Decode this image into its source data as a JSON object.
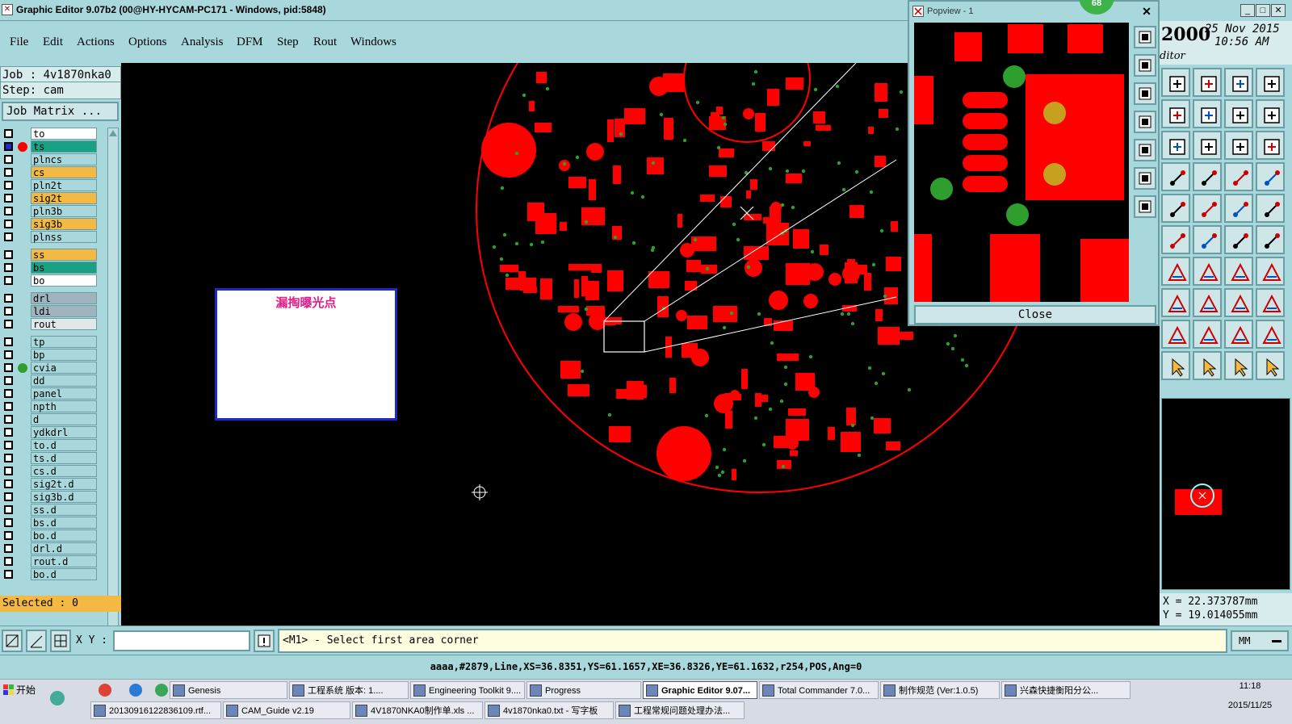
{
  "window": {
    "title": "Graphic Editor 9.07b2 (00@HY-HYCAM-PC171 - Windows, pid:5848)"
  },
  "menu": [
    {
      "label": "File"
    },
    {
      "label": "Edit"
    },
    {
      "label": "Actions"
    },
    {
      "label": "Options"
    },
    {
      "label": "Analysis"
    },
    {
      "label": "DFM"
    },
    {
      "label": "Step"
    },
    {
      "label": "Rout"
    },
    {
      "label": "Windows"
    }
  ],
  "job": {
    "job_line": "Job : 4v1870nka0",
    "step_line": "Step: cam",
    "matrix_button": "Job Matrix ..."
  },
  "layers": [
    {
      "name": "to",
      "color": "#ffffff"
    },
    {
      "name": "ts",
      "color": "#1aa083",
      "active": true
    },
    {
      "name": "plncs",
      "color": "#a8d8dc"
    },
    {
      "name": "cs",
      "color": "#f4b942"
    },
    {
      "name": "pln2t",
      "color": "#a8d8dc"
    },
    {
      "name": "sig2t",
      "color": "#f4b942"
    },
    {
      "name": "pln3b",
      "color": "#a8d8dc"
    },
    {
      "name": "sig3b",
      "color": "#f4b942"
    },
    {
      "name": "plnss",
      "color": "#a8d8dc"
    },
    {
      "name": "ss",
      "color": "#f4b942"
    },
    {
      "name": "bs",
      "color": "#1aa083"
    },
    {
      "name": "bo",
      "color": "#ffffff"
    },
    {
      "name": "drl",
      "color": "#9fb4bd"
    },
    {
      "name": "ldi",
      "color": "#9fb4bd"
    },
    {
      "name": "rout",
      "color": "#e0e8ea"
    },
    {
      "name": "tp",
      "color": "#a8d8dc"
    },
    {
      "name": "bp",
      "color": "#a8d8dc"
    },
    {
      "name": "cvia",
      "color": "#a8d8dc"
    },
    {
      "name": "dd",
      "color": "#a8d8dc"
    },
    {
      "name": "panel",
      "color": "#a8d8dc"
    },
    {
      "name": "npth",
      "color": "#a8d8dc"
    },
    {
      "name": "d",
      "color": "#a8d8dc"
    },
    {
      "name": "ydkdrl",
      "color": "#a8d8dc"
    },
    {
      "name": "to.d",
      "color": "#a8d8dc"
    },
    {
      "name": "ts.d",
      "color": "#a8d8dc"
    },
    {
      "name": "cs.d",
      "color": "#a8d8dc"
    },
    {
      "name": "sig2t.d",
      "color": "#a8d8dc"
    },
    {
      "name": "sig3b.d",
      "color": "#a8d8dc"
    },
    {
      "name": "ss.d",
      "color": "#a8d8dc"
    },
    {
      "name": "bs.d",
      "color": "#a8d8dc"
    },
    {
      "name": "bo.d",
      "color": "#a8d8dc"
    },
    {
      "name": "drl.d",
      "color": "#a8d8dc"
    },
    {
      "name": "rout.d",
      "color": "#a8d8dc"
    },
    {
      "name": "bo.d",
      "color": "#a8d8dc"
    }
  ],
  "selected": "Selected : 0",
  "note": {
    "text": "漏掏曝光点"
  },
  "popview": {
    "title": "Popview - 1",
    "badge": "68",
    "close_label": "Close"
  },
  "clock": {
    "year": "2000",
    "date": "25 Nov 2015",
    "time": "10:56 AM",
    "app": "ditor"
  },
  "coords": {
    "x": "X = 22.373787mm",
    "y": "Y = 19.014055mm"
  },
  "command": {
    "xy_label": "X Y :",
    "xy_value": "",
    "prompt": "<M1> - Select first area corner",
    "units": "MM"
  },
  "status": {
    "text": "aaaa,#2879,Line,XS=36.8351,YS=61.1657,XE=36.8326,YE=61.1632,r254,POS,Ang=0"
  },
  "taskbar": {
    "start": "开始",
    "row1": [
      {
        "label": "Genesis"
      },
      {
        "label": "工程系统  版本: 1...."
      },
      {
        "label": "Engineering Toolkit 9...."
      },
      {
        "label": "Progress"
      },
      {
        "label": "Graphic Editor 9.07...",
        "active": true
      },
      {
        "label": "Total Commander 7.0..."
      },
      {
        "label": "制作规范 (Ver:1.0.5)"
      },
      {
        "label": "兴森快捷衡阳分公..."
      }
    ],
    "row2": [
      {
        "label": "20130916122836109.rtf..."
      },
      {
        "label": "CAM_Guide v2.19"
      },
      {
        "label": "4V1870NKA0制作单.xls ..."
      },
      {
        "label": "4v1870nka0.txt - 写字板"
      },
      {
        "label": "工程常规问题处理办法..."
      }
    ],
    "time": "11:18",
    "date": "2015/11/25"
  },
  "colors": {
    "panel": "#a8d8dc",
    "copper": "#ff0000",
    "via": "#2e9e2e",
    "selected_layer": "#1aa083",
    "highlight": "#f4b942",
    "note_border": "#1a2bc8",
    "note_text": "#e0208a"
  }
}
